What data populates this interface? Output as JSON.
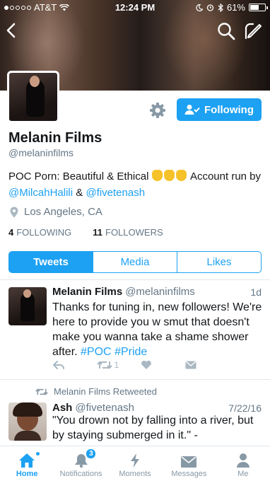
{
  "status_bar": {
    "carrier": "AT&T",
    "time": "12:24 PM",
    "battery": "61%",
    "battery_level": 0.61
  },
  "profile": {
    "name": "Melanin Films",
    "handle": "@melaninfilms",
    "bio_text_1": "POC Porn: Beautiful & Ethical",
    "bio_text_2": "Account run by",
    "bio_mention_1": "@MilcahHalili",
    "bio_amp": "&",
    "bio_mention_2": "@fivetenash",
    "location": "Los Angeles, CA",
    "following_count": "4",
    "following_label": "FOLLOWING",
    "followers_count": "11",
    "followers_label": "FOLLOWERS",
    "follow_button": "Following"
  },
  "tabs": [
    {
      "label": "Tweets",
      "active": true
    },
    {
      "label": "Media",
      "active": false
    },
    {
      "label": "Likes",
      "active": false
    }
  ],
  "tweets": [
    {
      "name": "Melanin Films",
      "handle": "@melaninfilms",
      "time": "1d",
      "text": "Thanks for tuning in, new followers! We're here to provide you w smut that doesn't make you wanna take a shame shower after.",
      "hashtag_1": "#POC",
      "hashtag_2": "#Pride",
      "retweet_count": "1"
    },
    {
      "retweeted_by": "Melanin Films Retweeted",
      "name": "Ash",
      "handle": "@fivetenash",
      "time": "7/22/16",
      "text": "\"You drown not by falling into a river, but by staying submerged in it.\" -"
    }
  ],
  "tab_bar": [
    {
      "label": "Home",
      "icon": "home-icon",
      "active": true
    },
    {
      "label": "Notifications",
      "icon": "bell-icon",
      "badge": "3"
    },
    {
      "label": "Moments",
      "icon": "lightning-icon"
    },
    {
      "label": "Messages",
      "icon": "envelope-icon"
    },
    {
      "label": "Me",
      "icon": "person-icon"
    }
  ],
  "colors": {
    "accent": "#1da1f2",
    "muted": "#657786",
    "icon_gray": "#aab8c2"
  }
}
